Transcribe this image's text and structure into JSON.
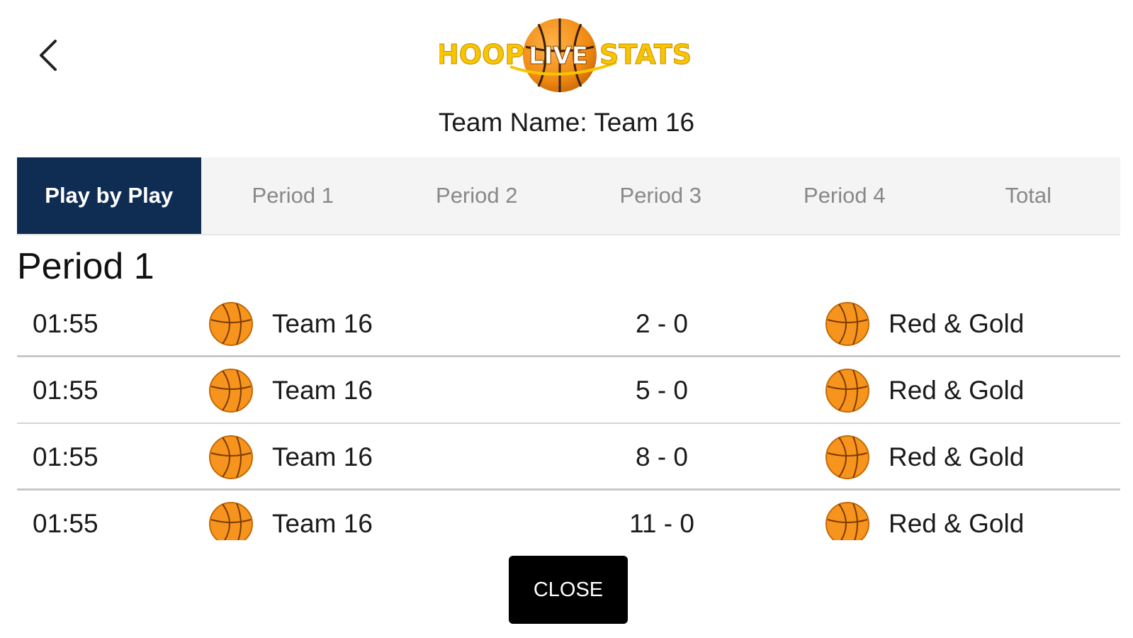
{
  "header": {
    "back_icon": "chevron-left-icon",
    "logo_text": "HOOPLIVESTATS",
    "team_name": "Team Name: Team 16"
  },
  "tabs": [
    {
      "label": "Play by Play",
      "active": true
    },
    {
      "label": "Period 1",
      "active": false
    },
    {
      "label": "Period 2",
      "active": false
    },
    {
      "label": "Period 3",
      "active": false
    },
    {
      "label": "Period 4",
      "active": false
    },
    {
      "label": "Total",
      "active": false
    }
  ],
  "section": {
    "title": "Period 1"
  },
  "plays": [
    {
      "time": "01:55",
      "team": "Team 16",
      "score": "2 - 0",
      "opponent": "Red & Gold"
    },
    {
      "time": "01:55",
      "team": "Team 16",
      "score": "5 - 0",
      "opponent": "Red & Gold"
    },
    {
      "time": "01:55",
      "team": "Team 16",
      "score": "8 - 0",
      "opponent": "Red & Gold"
    },
    {
      "time": "01:55",
      "team": "Team 16",
      "score": "11 - 0",
      "opponent": "Red & Gold"
    }
  ],
  "footer": {
    "close_label": "CLOSE"
  },
  "colors": {
    "active_tab": "#0f2d52",
    "ball": "#f7941d",
    "logo_yellow": "#f7c600"
  }
}
